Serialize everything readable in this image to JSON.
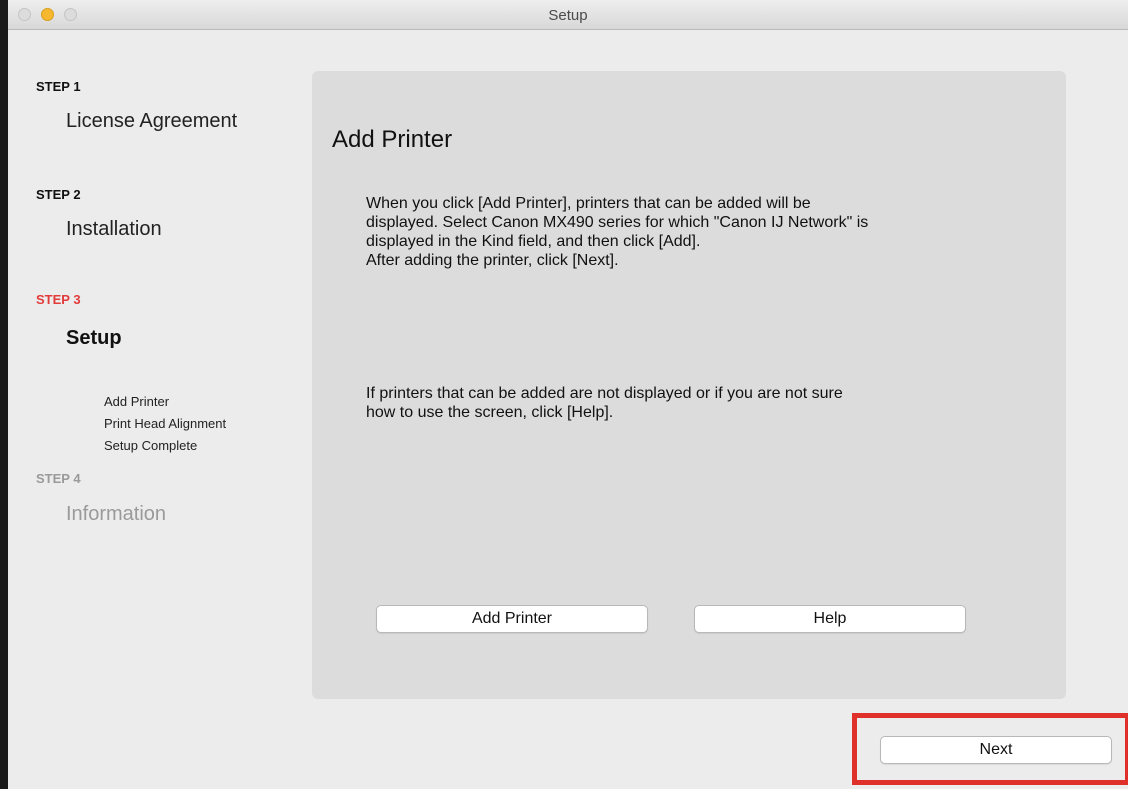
{
  "window": {
    "title": "Setup"
  },
  "steps": [
    {
      "label": "STEP 1",
      "name": "License Agreement"
    },
    {
      "label": "STEP 2",
      "name": "Installation"
    },
    {
      "label": "STEP 3",
      "name": "Setup",
      "substeps": [
        "Add Printer",
        "Print Head Alignment",
        "Setup Complete"
      ]
    },
    {
      "label": "STEP 4",
      "name": "Information"
    }
  ],
  "panel": {
    "title": "Add Printer",
    "instructions": "When you click [Add Printer], printers that can be added will be\ndisplayed. Select Canon MX490 series for which \"Canon IJ Network\" is\ndisplayed in the Kind field, and then click [Add].\nAfter adding the printer, click [Next].",
    "help_text": "If printers that can be added are not displayed or if you are not sure\nhow to use the screen, click [Help].",
    "add_printer_label": "Add Printer",
    "help_label": "Help"
  },
  "footer": {
    "next_label": "Next"
  },
  "colors": {
    "current_step": "#e23b3b",
    "future_step": "#9a9a9a",
    "highlight": "#e0302a",
    "minimize_light": "#f5b82e"
  }
}
